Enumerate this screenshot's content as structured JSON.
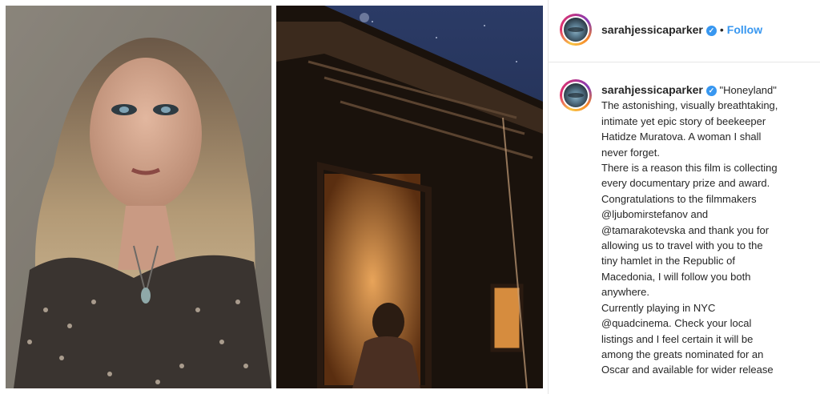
{
  "post": {
    "username": "sarahjessicaparker",
    "separator": "•",
    "follow_label": "Follow",
    "verified_glyph": "✓",
    "caption_title": "\"Honeyland\"",
    "caption_lines": [
      "The astonishing, visually breathtaking,",
      "intimate yet epic story of beekeeper",
      "Hatidze Muratova. A woman I shall",
      "never forget.",
      "There is a reason this film is collecting",
      "every documentary prize and award.",
      "Congratulations to the filmmakers",
      "@ljubomirstefanov and",
      "@tamarakotevska and thank you for",
      "allowing us to travel with you to the",
      "tiny hamlet in the Republic of",
      "Macedonia, I will follow you both",
      "anywhere.",
      "Currently playing in NYC",
      "@quadcinema. Check your local",
      "listings and I feel certain it will be",
      "among the greats nominated for an",
      "Oscar and available for wider release"
    ]
  },
  "icons": {
    "avatar": "profile-avatar-icon",
    "verified": "verified-badge-icon"
  },
  "colors": {
    "link_blue": "#3897f0",
    "text": "#262626",
    "divider": "#e6e6e6"
  }
}
